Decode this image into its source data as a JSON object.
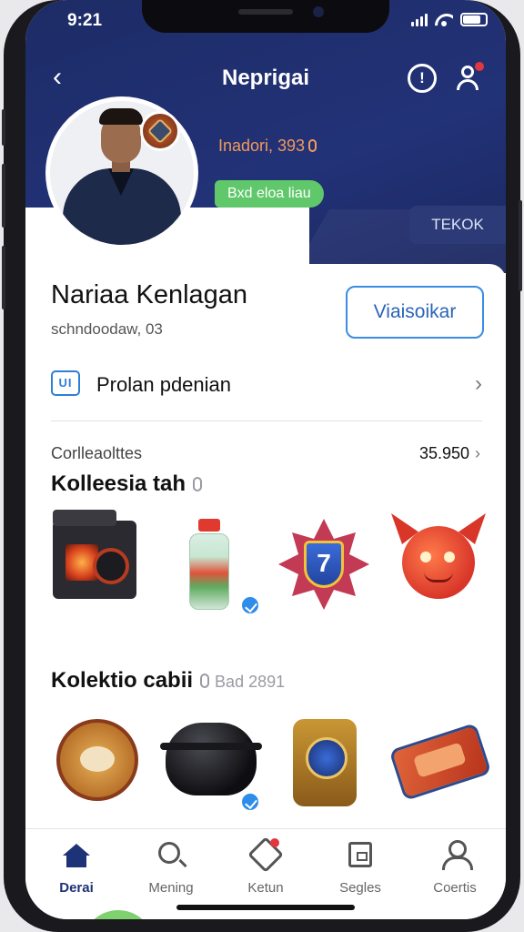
{
  "status_bar": {
    "time": "9:21"
  },
  "header": {
    "title": "Neprigai",
    "back_icon": "chevron-left-icon",
    "help_icon": "help-icon",
    "account_icon": "user-notification-icon",
    "level_text": "Inadori, 393",
    "status_pill": "Bxd eloa liau",
    "side_chip": "TEKOK"
  },
  "profile": {
    "name": "Nariaa Kenlagan",
    "subtitle": "schndoodaw, 03",
    "follow_button": "Viaisoikar"
  },
  "menu": {
    "label": "Prolan pdenian",
    "icon_text": "UI"
  },
  "stats": {
    "label": "Corlleaolttes",
    "value": "35.950",
    "chevron": "›"
  },
  "section1": {
    "title": "Kolleesia tah"
  },
  "section2": {
    "title": "Kolektio cabii",
    "hint": "Bad 2891"
  },
  "tabbar": {
    "items": [
      {
        "label": "Derai",
        "icon": "home-icon",
        "active": true
      },
      {
        "label": "Mening",
        "icon": "search-icon",
        "active": false
      },
      {
        "label": "Ketun",
        "icon": "gift-icon",
        "active": false
      },
      {
        "label": "Segles",
        "icon": "document-icon",
        "active": false
      },
      {
        "label": "Coertis",
        "icon": "user-icon",
        "active": false
      }
    ]
  },
  "colors": {
    "header_bg": "#1d2b66",
    "accent_blue": "#3a8de0",
    "active_tab": "#1e3278",
    "pill_green": "#60c86a",
    "level_orange": "#f09a5c",
    "notification_red": "#e2373f"
  }
}
